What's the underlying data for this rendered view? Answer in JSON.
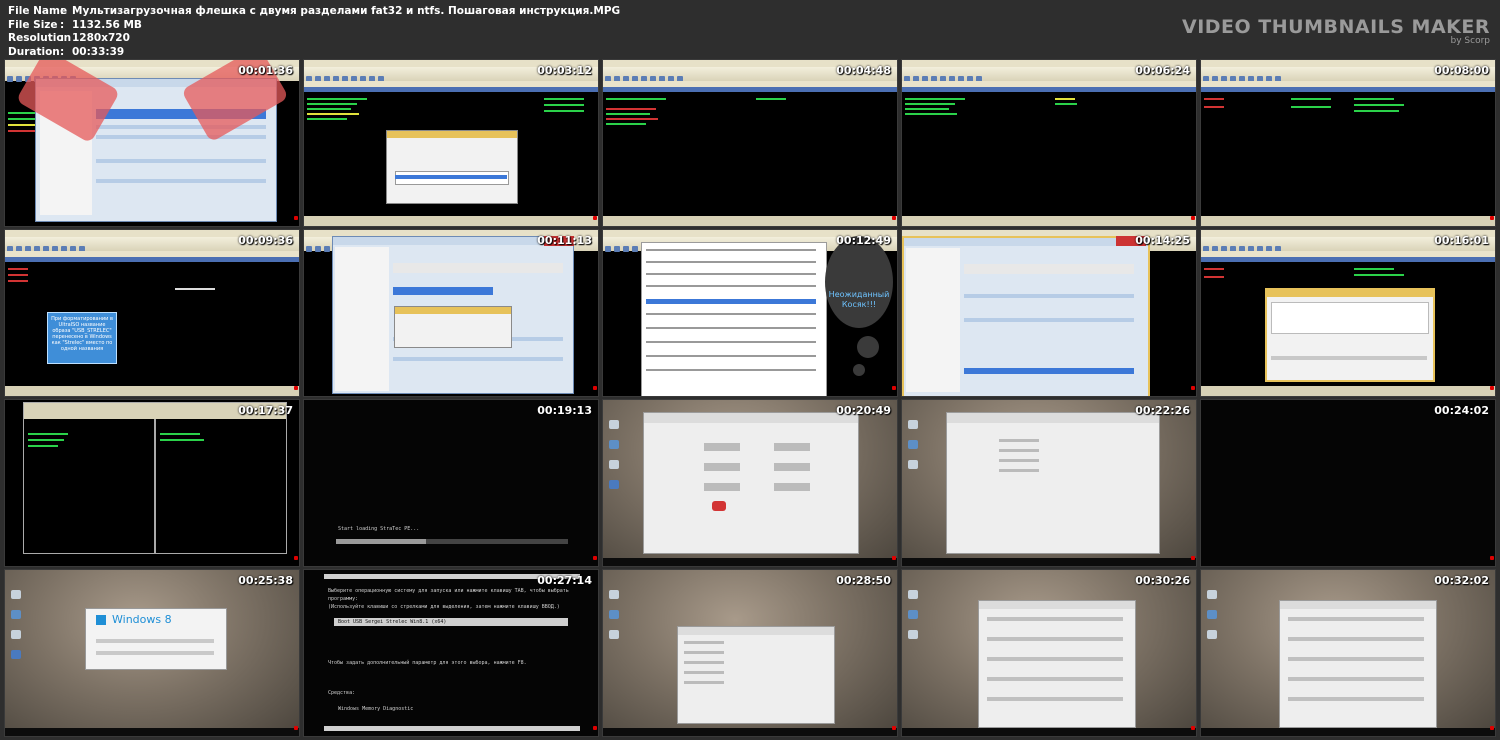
{
  "info": {
    "file_name_label": "File Name",
    "file_name": "Мультизагрузочная флешка с двумя разделами fat32 и ntfs. Пошаговая инструкция.MPG",
    "file_size_label": "File Size",
    "file_size": "1132.56 MB",
    "resolution_label": "Resolution",
    "resolution": "1280x720",
    "duration_label": "Duration",
    "duration": "00:33:39",
    "separator": ":"
  },
  "brand": {
    "title": "VIDEO THUMBNAILS MAKER",
    "subtitle": "by Scorp"
  },
  "thumbnails": [
    {
      "time": "00:01:36"
    },
    {
      "time": "00:03:12"
    },
    {
      "time": "00:04:48"
    },
    {
      "time": "00:06:24"
    },
    {
      "time": "00:08:00"
    },
    {
      "time": "00:09:36"
    },
    {
      "time": "00:11:13"
    },
    {
      "time": "00:12:49"
    },
    {
      "time": "00:14:25"
    },
    {
      "time": "00:16:01"
    },
    {
      "time": "00:17:37"
    },
    {
      "time": "00:19:13"
    },
    {
      "time": "00:20:49"
    },
    {
      "time": "00:22:26"
    },
    {
      "time": "00:24:02"
    },
    {
      "time": "00:25:38"
    },
    {
      "time": "00:27:14"
    },
    {
      "time": "00:28:50"
    },
    {
      "time": "00:30:26"
    },
    {
      "time": "00:32:02"
    }
  ],
  "captions": {
    "bubble_text": "При форматировании в UltraISO название образа \"USB_STRELEC\" перенесено в Windows как \"Strelec\" вместо по одной названия",
    "cloud_text": "Неожиданный Косяк!!!",
    "loading_text": "Start loading StraTec PE...",
    "win8_text": "Windows 8",
    "boot_line1": "Выберите операционную систему для запуска или нажмите клавишу TAB, чтобы выбрать",
    "boot_line2": "программу:",
    "boot_line3": "(Используйте клавиши со стрелками для выделения, затем нажмите клавишу ВВОД.)",
    "boot_item1": "Boot USB Sergei Strelec Win8.1 (x64)",
    "boot_line4": "Чтобы задать дополнительный параметр для этого выбора, нажмите F8.",
    "boot_tools": "Средства:",
    "boot_item2": "Windows Memory Diagnostic"
  }
}
